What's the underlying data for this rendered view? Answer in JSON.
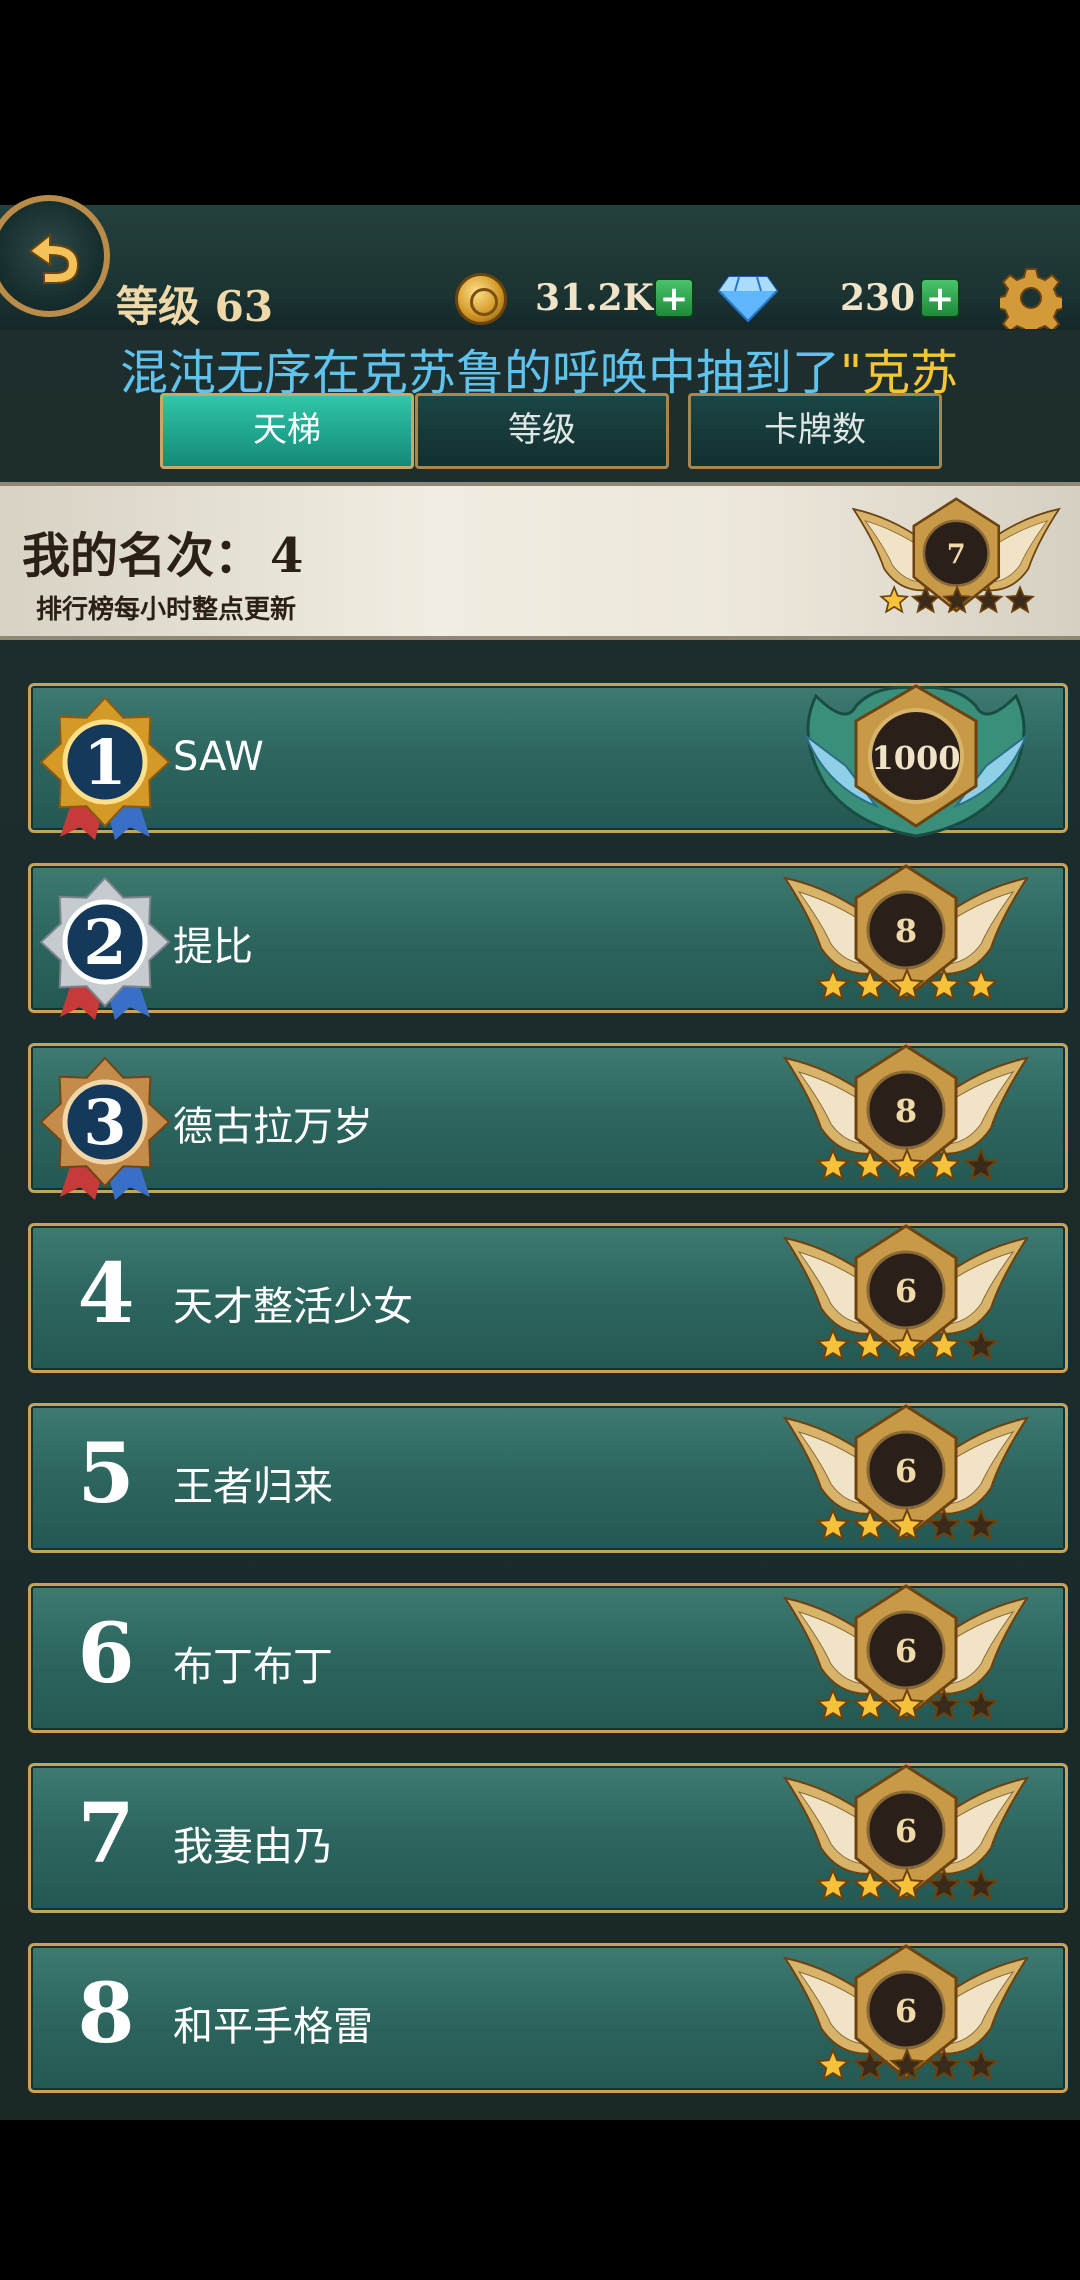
{
  "header": {
    "level_label": "等级 63",
    "coins": "31.2K",
    "gems": "230",
    "marquee": "混沌无序在克苏鲁的呼唤中抽到了",
    "marquee_highlight": "\"克苏"
  },
  "tabs": [
    {
      "label": "天梯",
      "active": true
    },
    {
      "label": "等级",
      "active": false
    },
    {
      "label": "卡牌数",
      "active": false
    }
  ],
  "my_rank": {
    "label": "我的名次：",
    "value": "4",
    "note": "排行榜每小时整点更新",
    "badge_level": "7",
    "badge_stars": 1
  },
  "leaderboard": [
    {
      "rank": "1",
      "name": "SAW",
      "score": "1000",
      "medal": "gold",
      "stars": 0,
      "top": true
    },
    {
      "rank": "2",
      "name": "提比",
      "score": "8",
      "medal": "silver",
      "stars": 5
    },
    {
      "rank": "3",
      "name": "德古拉万岁",
      "score": "8",
      "medal": "bronze",
      "stars": 4
    },
    {
      "rank": "4",
      "name": "天才整活少女",
      "score": "6",
      "medal": "",
      "stars": 4
    },
    {
      "rank": "5",
      "name": "王者归来",
      "score": "6",
      "medal": "",
      "stars": 3
    },
    {
      "rank": "6",
      "name": "布丁布丁",
      "score": "6",
      "medal": "",
      "stars": 3
    },
    {
      "rank": "7",
      "name": "我妻由乃",
      "score": "6",
      "medal": "",
      "stars": 3
    },
    {
      "rank": "8",
      "name": "和平手格雷",
      "score": "6",
      "medal": "",
      "stars": 1
    }
  ],
  "colors": {
    "gold": "#c7a25a",
    "row": "#2d6760",
    "tab_active": "#22a88f",
    "marquee": "#5fc3ee"
  }
}
